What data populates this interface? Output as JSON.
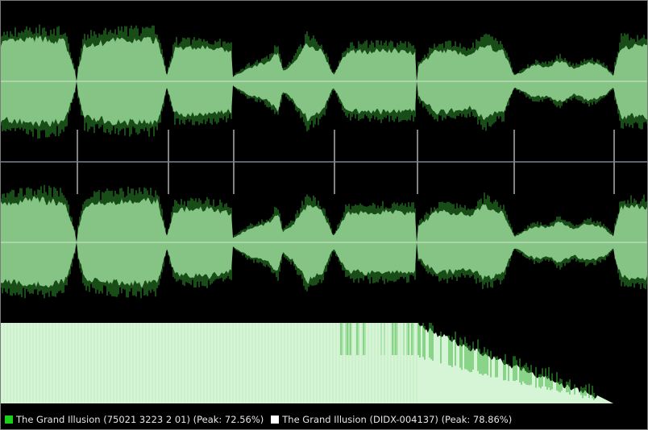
{
  "colors": {
    "background": "#000000",
    "fill_a": "#00d000",
    "fill_b": "#ffffff",
    "wave_fill": "#86c486",
    "wave_peak": "#2f9a2f",
    "spectrum_fill": "#d6f5d6",
    "center_line": "#cfe9cf",
    "divider": "#7a8292",
    "marker": "#d8d8d8"
  },
  "track_markers_px_note": "",
  "legend": [
    {
      "label": "The Grand Illusion (75021 3223 2 01) (Peak: 72.56%)",
      "swatch_color": "#19d119",
      "swatch_icon": "green-square-icon"
    },
    {
      "label": "The Grand Illusion (DIDX-004137) (Peak: 78.86%)",
      "swatch_color": "#ffffff",
      "swatch_icon": "white-square-icon"
    }
  ]
}
